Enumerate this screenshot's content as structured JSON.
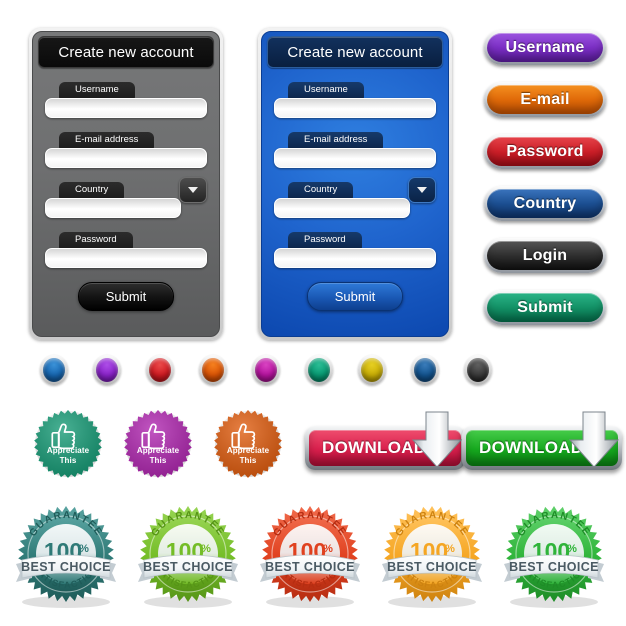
{
  "forms": [
    {
      "id": "gray",
      "theme": "dark-gray",
      "title": "Create new account",
      "fields": [
        {
          "label": "Username",
          "value": "",
          "placeholder": "",
          "type": "text"
        },
        {
          "label": "E-mail address",
          "value": "",
          "placeholder": "",
          "type": "text"
        },
        {
          "label": "Country",
          "value": "",
          "placeholder": "",
          "type": "select"
        },
        {
          "label": "Password",
          "value": "",
          "placeholder": "",
          "type": "password"
        }
      ],
      "submit_label": "Submit"
    },
    {
      "id": "blue",
      "theme": "blue",
      "title": "Create new account",
      "fields": [
        {
          "label": "Username",
          "value": "",
          "placeholder": "",
          "type": "text"
        },
        {
          "label": "E-mail address",
          "value": "",
          "placeholder": "",
          "type": "text"
        },
        {
          "label": "Country",
          "value": "",
          "placeholder": "",
          "type": "select"
        },
        {
          "label": "Password",
          "value": "",
          "placeholder": "",
          "type": "password"
        }
      ],
      "submit_label": "Submit"
    }
  ],
  "pill_buttons": [
    {
      "label": "Username",
      "color": "#7b2fc4",
      "color_light": "#9c54e0",
      "color_dark": "#5a1b9c"
    },
    {
      "label": "E-mail",
      "color": "#e06a09",
      "color_light": "#f59020",
      "color_dark": "#bc4e02"
    },
    {
      "label": "Password",
      "color": "#cc1f28",
      "color_light": "#e6434a",
      "color_dark": "#9e0c16"
    },
    {
      "label": "Country",
      "color": "#1c4f92",
      "color_light": "#3a74bd",
      "color_dark": "#0d3268"
    },
    {
      "label": "Login",
      "color": "#2f2f2f",
      "color_light": "#555555",
      "color_dark": "#101010"
    },
    {
      "label": "Submit",
      "color": "#139166",
      "color_light": "#2bb487",
      "color_dark": "#046c49"
    }
  ],
  "dots": [
    {
      "name": "dot-blue",
      "color": "#1766b0",
      "light": "#3b92d8",
      "dark": "#0c4781"
    },
    {
      "name": "dot-purple",
      "color": "#8a23c9",
      "light": "#ad4ee8",
      "dark": "#66109c"
    },
    {
      "name": "dot-red",
      "color": "#cf1b22",
      "light": "#ea4a4a",
      "dark": "#9c0d14"
    },
    {
      "name": "dot-orange",
      "color": "#da5405",
      "light": "#f5801f",
      "dark": "#a83a01"
    },
    {
      "name": "dot-magenta",
      "color": "#b5139e",
      "light": "#d943c2",
      "dark": "#8a0876"
    },
    {
      "name": "dot-teal",
      "color": "#089972",
      "light": "#2bbd95",
      "dark": "#006e52"
    },
    {
      "name": "dot-yellow",
      "color": "#c9ae05",
      "light": "#e6cf22",
      "dark": "#9a8300"
    },
    {
      "name": "dot-navy",
      "color": "#13548f",
      "light": "#3a7cba",
      "dark": "#083a69"
    },
    {
      "name": "dot-black",
      "color": "#3a3a3a",
      "light": "#606060",
      "dark": "#121212"
    }
  ],
  "appreciate_badges": [
    {
      "line1": "Appreciate",
      "line2": "This",
      "color": "#169b76",
      "color_dark": "#0d7a5c",
      "icon": "thumbs-up-icon"
    },
    {
      "line1": "Appreciate",
      "line2": "This",
      "color": "#b026b0",
      "color_dark": "#8b1a8b",
      "icon": "thumbs-up-icon"
    },
    {
      "line1": "Appreciate",
      "line2": "This",
      "color": "#e05c0e",
      "color_dark": "#b8450a",
      "icon": "thumbs-up-icon"
    }
  ],
  "download_buttons": [
    {
      "label": "DOWNLOAD",
      "color_light": "#ef4d6e",
      "color": "#d81f4c",
      "color_dark": "#a80d34",
      "icon": "down-arrow-icon"
    },
    {
      "label": "DOWNLOAD",
      "color_light": "#46cc4a",
      "color": "#16a81e",
      "color_dark": "#0a7d12",
      "icon": "down-arrow-icon"
    }
  ],
  "seals": [
    {
      "top_text": "GUARANTEE",
      "percent": "100",
      "percent_symbol": "%",
      "ribbon_text": "BEST CHOICE",
      "bottom_text": "SATISFACTION",
      "color": "#2f7a77",
      "color_dark": "#1f5c59",
      "color_light": "#59a3a0"
    },
    {
      "top_text": "GUARANTEE",
      "percent": "100",
      "percent_symbol": "%",
      "ribbon_text": "BEST CHOICE",
      "bottom_text": "SATISFACTION",
      "color": "#74bd27",
      "color_dark": "#569417",
      "color_light": "#97d453"
    },
    {
      "top_text": "GUARANTEE",
      "percent": "100",
      "percent_symbol": "%",
      "ribbon_text": "BEST CHOICE",
      "bottom_text": "SATISFACTION",
      "color": "#e0411f",
      "color_dark": "#b52d12",
      "color_light": "#f06b4c"
    },
    {
      "top_text": "GUARANTEE",
      "percent": "100",
      "percent_symbol": "%",
      "ribbon_text": "BEST CHOICE",
      "bottom_text": "SATISFACTION",
      "color": "#f5a623",
      "color_dark": "#cd8210",
      "color_light": "#ffc25c"
    },
    {
      "top_text": "GUARANTEE",
      "percent": "100",
      "percent_symbol": "%",
      "ribbon_text": "BEST CHOICE",
      "bottom_text": "SATISFACTION",
      "color": "#2fb43a",
      "color_dark": "#1e8c27",
      "color_light": "#5ed069"
    }
  ]
}
